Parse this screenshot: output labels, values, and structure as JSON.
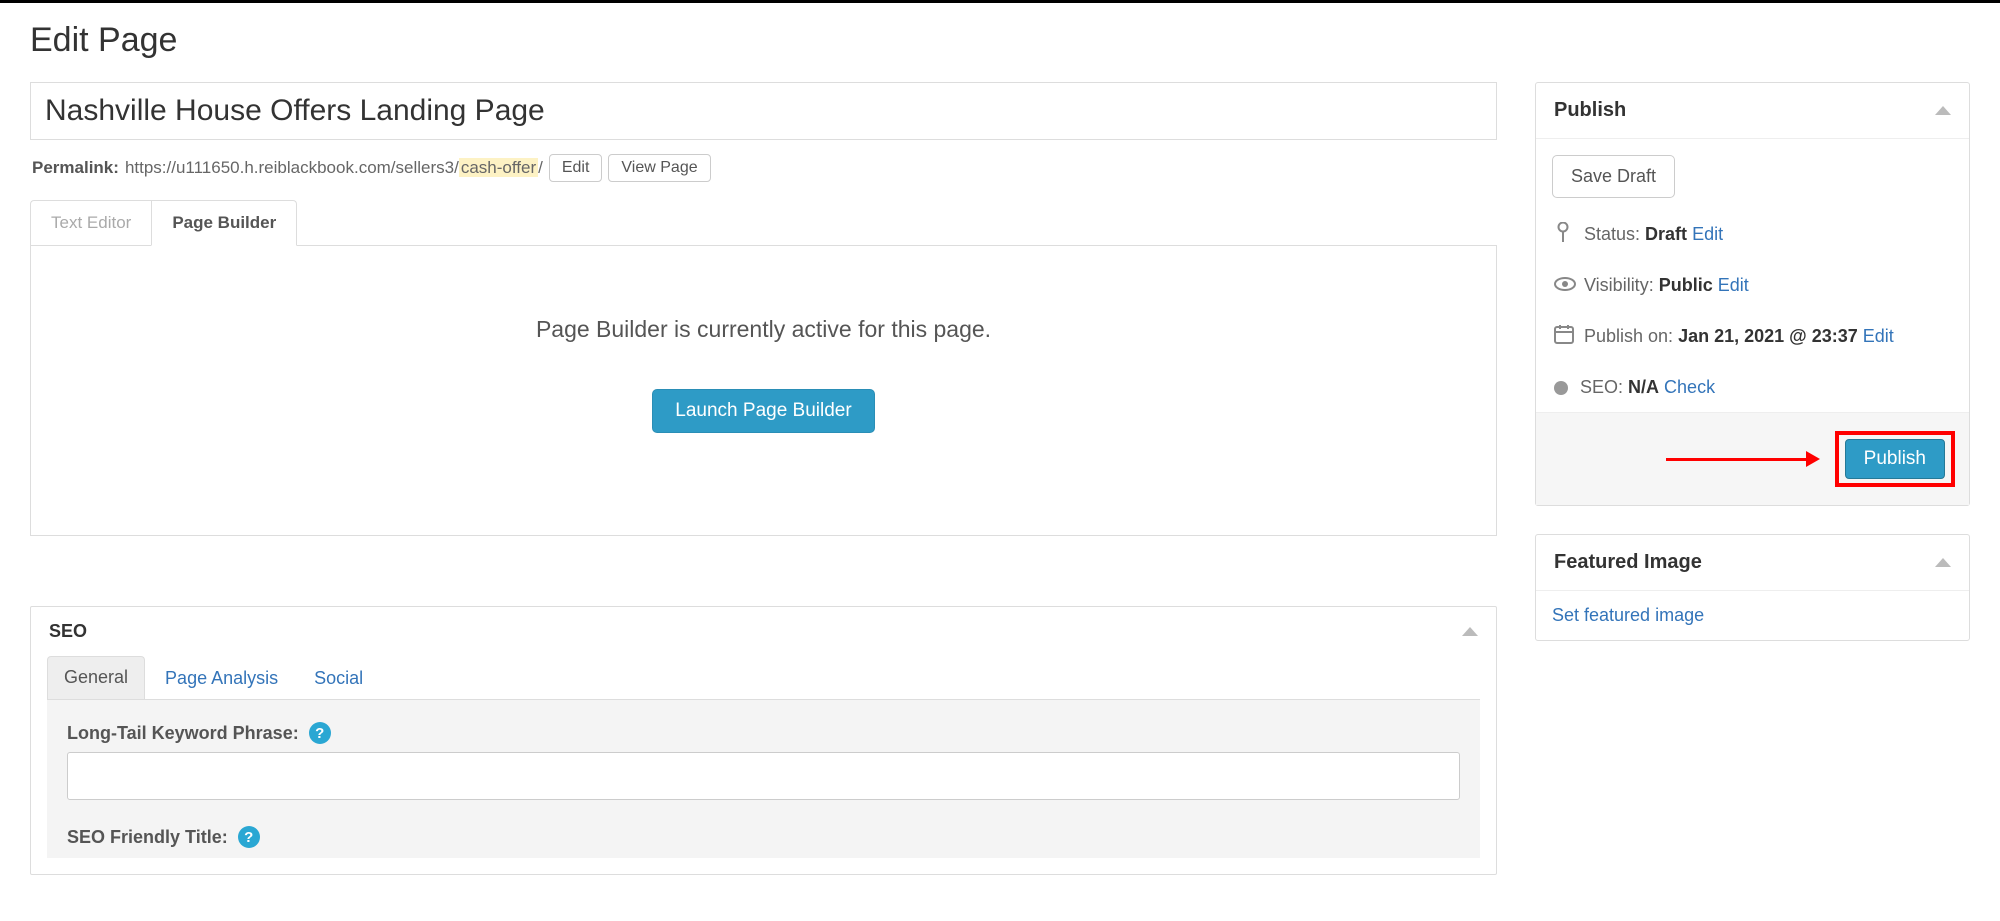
{
  "pageHeading": "Edit Page",
  "titleValue": "Nashville House Offers Landing Page",
  "permalink": {
    "label": "Permalink:",
    "base": "https://u111650.h.reiblackbook.com/sellers3/",
    "slug": "cash-offer",
    "trail": "/",
    "editBtn": "Edit",
    "viewBtn": "View Page"
  },
  "editorTabs": {
    "text": "Text Editor",
    "builder": "Page Builder"
  },
  "builder": {
    "message": "Page Builder is currently active for this page.",
    "launchBtn": "Launch Page Builder"
  },
  "seo": {
    "header": "SEO",
    "tabs": {
      "general": "General",
      "analysis": "Page Analysis",
      "social": "Social"
    },
    "longTailLabel": "Long-Tail Keyword Phrase:",
    "longTailValue": "",
    "friendlyTitleLabel": "SEO Friendly Title:"
  },
  "publish": {
    "header": "Publish",
    "saveDraft": "Save Draft",
    "statusLabel": "Status:",
    "statusValue": "Draft",
    "statusEdit": "Edit",
    "visibilityLabel": "Visibility:",
    "visibilityValue": "Public",
    "visibilityEdit": "Edit",
    "publishOnLabel": "Publish on:",
    "publishOnValue": "Jan 21, 2021 @ 23:37",
    "publishOnEdit": "Edit",
    "seoLabel": "SEO:",
    "seoValue": "N/A",
    "seoCheck": "Check",
    "publishBtn": "Publish"
  },
  "featured": {
    "header": "Featured Image",
    "setLink": "Set featured image"
  }
}
